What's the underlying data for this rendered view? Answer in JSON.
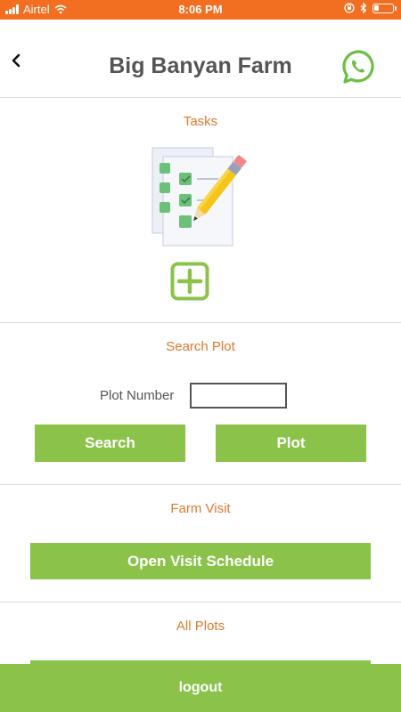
{
  "status_bar": {
    "carrier": "Airtel",
    "time": "8:06 PM",
    "battery_level": 0.25
  },
  "header": {
    "title": "Big Banyan Farm",
    "back_icon": "chevron-left-icon",
    "action_icon": "whatsapp-icon"
  },
  "tasks": {
    "title": "Tasks",
    "illustration_icon": "task-checklist-pencil-icon",
    "add_icon": "plus-square-icon"
  },
  "search_plot": {
    "title": "Search Plot",
    "field_label": "Plot Number",
    "field_value": "",
    "search_label": "Search",
    "plot_label": "Plot"
  },
  "farm_visit": {
    "title": "Farm Visit",
    "button_label": "Open Visit Schedule"
  },
  "all_plots": {
    "title": "All Plots"
  },
  "footer": {
    "logout_label": "logout"
  },
  "colors": {
    "status_bar": "#F26F21",
    "accent_green": "#8BC34A",
    "section_title": "#E0782F",
    "whatsapp": "#6CBE45"
  }
}
